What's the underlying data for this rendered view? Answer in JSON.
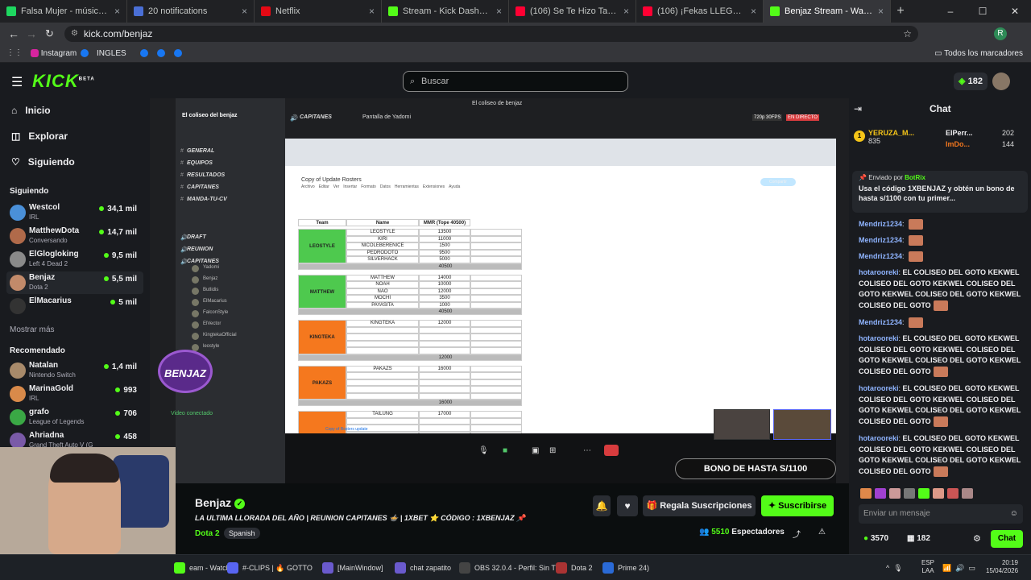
{
  "browser": {
    "tabs": [
      {
        "label": "Falsa Mujer - música y letra de",
        "color": "#1ed760"
      },
      {
        "label": "20 notifications",
        "color": "#4a6fd6"
      },
      {
        "label": "Netflix",
        "color": "#e50914"
      },
      {
        "label": "Stream - Kick Dashboard",
        "color": "#53fc18"
      },
      {
        "label": "(106) Se Te Hizo Tarde (feat. Ele",
        "color": "#ff0033"
      },
      {
        "label": "(106) ¡Fekas LLEGAN a Colo",
        "color": "#ff0033"
      },
      {
        "label": "Benjaz Stream - Watch Live",
        "color": "#53fc18"
      }
    ],
    "url": "kick.com/benjaz",
    "bookmarks": [
      "Instagram",
      "INGLES"
    ],
    "bookmarks_folder": "Todos los marcadores"
  },
  "kick": {
    "logo": "KICK",
    "logo_beta": "BETA",
    "search_placeholder": "Buscar",
    "kicks_balance": "182",
    "nav": [
      {
        "label": "Inicio",
        "icon": "home-icon"
      },
      {
        "label": "Explorar",
        "icon": "compass-icon"
      },
      {
        "label": "Siguiendo",
        "icon": "heart-icon"
      }
    ],
    "following_header": "Siguiendo",
    "following": [
      {
        "name": "Westcol",
        "game": "IRL",
        "viewers": "34,1 mil",
        "color": "#4a90d9"
      },
      {
        "name": "MatthewDota",
        "game": "Conversando",
        "viewers": "14,7 mil",
        "color": "#b06a4a"
      },
      {
        "name": "ElGlogloking",
        "game": "Left 4 Dead 2",
        "viewers": "9,5 mil",
        "color": "#8a8a8a"
      },
      {
        "name": "Benjaz",
        "game": "Dota 2",
        "viewers": "5,5 mil",
        "color": "#c28a6a"
      },
      {
        "name": "ElMacarius",
        "game": "",
        "viewers": "5 mil",
        "color": "#333"
      }
    ],
    "show_more": "Mostrar más",
    "recommended_header": "Recomendado",
    "recommended": [
      {
        "name": "Natalan",
        "game": "Nintendo Switch",
        "viewers": "1,4 mil",
        "color": "#a88a6a"
      },
      {
        "name": "MarinaGold",
        "game": "IRL",
        "viewers": "993",
        "color": "#d98a4a"
      },
      {
        "name": "grafo",
        "game": "League of Legends",
        "viewers": "706",
        "color": "#3aa845"
      },
      {
        "name": "Ahriadna",
        "game": "Grand Theft Auto V (G",
        "viewers": "458",
        "color": "#7a5aa8"
      }
    ]
  },
  "stream": {
    "discord_server": "El coliseo del benjaz",
    "discord_title": "El coliseo de benjaz",
    "discord_channels": [
      "GENERAL",
      "EQUIPOS",
      "RESULTADOS",
      "CAPITANES",
      "MANDA-TU-CV",
      "DRAFT",
      "REUNION",
      "CAPITANES"
    ],
    "discord_live_label": "EN DIRECTO",
    "discord_voice_channel": "CAPITANES",
    "discord_screen": "Pantalla de Yadomi",
    "discord_quality": "720p 30FPS",
    "voice_users": [
      "Yadomi",
      "Benjaz",
      "Butlidis",
      "ElMacarius",
      "FalconStyle",
      "ElVector",
      "KingtekaOfficial",
      "leostyle"
    ],
    "voice_status": "Video conectado",
    "sheet_title": "Copy of Update Rosters",
    "sheet_menu": [
      "Archivo",
      "Editar",
      "Ver",
      "Insertar",
      "Formato",
      "Datos",
      "Herramientas",
      "Extensiones",
      "Ayuda"
    ],
    "sheet_tab": "Copy of Rosters update",
    "sheet_headers": [
      "Team",
      "Name",
      "MMR (Tope 40500)"
    ],
    "teams": [
      {
        "team": "LEOSTYLE",
        "color": "#4ec94e",
        "players": [
          [
            "LEOSTYLE",
            "13500"
          ],
          [
            "KIRI",
            "11000"
          ],
          [
            "NICOLEBERENICE",
            "1500"
          ],
          [
            "PEDRODOTO",
            "9500"
          ],
          [
            "SILVERHACK",
            "5000"
          ]
        ],
        "total": "40500"
      },
      {
        "team": "MATTHEW",
        "color": "#4ec94e",
        "players": [
          [
            "MATTHEW",
            "14000"
          ],
          [
            "NOAH",
            "10000"
          ],
          [
            "NAO",
            "12000"
          ],
          [
            "MOCHI",
            "3500"
          ],
          [
            "PAYASITA",
            "1000"
          ]
        ],
        "total": "40500"
      },
      {
        "team": "KINGTEKA",
        "color": "#f5781e",
        "players": [
          [
            "KINGTEKA",
            "12000"
          ]
        ],
        "total": "12000"
      },
      {
        "team": "PAKAZS",
        "color": "#f5781e",
        "players": [
          [
            "PAKAZS",
            "16000"
          ]
        ],
        "total": "16000"
      },
      {
        "team": "",
        "color": "#f5781e",
        "players": [
          [
            "TAILUNG",
            "17000"
          ]
        ],
        "total": ""
      }
    ],
    "overlay_badge": "BENJAZ",
    "overlay_promo": "BONO DE HASTA S/1100",
    "streamer": "Benjaz",
    "title": "LA ULTIMA LLORADA DEL AÑO | REUNION CAPITANES 🍲 | 1XBET ⭐ CÓDIGO : 1XBENJAZ 📌",
    "category": "Dota 2",
    "language": "Spanish",
    "gift_label": "Regala Suscripciones",
    "subscribe_label": "Suscribirse",
    "viewers": "5510",
    "viewers_label": "Espectadores"
  },
  "chat": {
    "title": "Chat",
    "top_gifters": [
      {
        "name": "YERUZA_M...",
        "value": "835",
        "rank": "1"
      },
      {
        "name": "ElPerr...",
        "value": "202"
      },
      {
        "name": "ImDo...",
        "value": "144"
      }
    ],
    "pinned_by": "Enviado por",
    "pinned_user": "BotRix",
    "pinned_text": "Usa el código 1XBENJAZ y obtén un bono de hasta s/1100 con tu primer...",
    "messages": [
      {
        "user": "Mendriz1234",
        "text": ""
      },
      {
        "user": "Mendriz1234",
        "text": ""
      },
      {
        "user": "Mendriz1234",
        "text": ""
      },
      {
        "user": "hotarooreki",
        "text": "EL COLISEO DEL GOTO KEKWEL COLISEO DEL GOTO KEKWEL COLISEO DEL GOTO KEKWEL COLISEO DEL GOTO KEKWEL COLISEO DEL GOTO"
      },
      {
        "user": "Mendriz1234",
        "text": ""
      },
      {
        "user": "hotarooreki",
        "text": "EL COLISEO DEL GOTO KEKWEL COLISEO DEL GOTO KEKWEL COLISEO DEL GOTO KEKWEL COLISEO DEL GOTO KEKWEL COLISEO DEL GOTO"
      },
      {
        "user": "hotarooreki",
        "text": "EL COLISEO DEL GOTO KEKWEL COLISEO DEL GOTO KEKWEL COLISEO DEL GOTO KEKWEL COLISEO DEL GOTO KEKWEL COLISEO DEL GOTO"
      },
      {
        "user": "hotarooreki",
        "text": "EL COLISEO DEL GOTO KEKWEL COLISEO DEL GOTO KEKWEL COLISEO DEL GOTO KEKWEL COLISEO DEL GOTO KEKWEL COLISEO DEL GOTO"
      }
    ],
    "input_placeholder": "Enviar un mensaje",
    "points": "3570",
    "kicks": "182",
    "send_label": "Chat"
  },
  "taskbar": {
    "items": [
      "eam - Watch l",
      "#-CLIPS | 🔥 GOTTO",
      "[MainWindow]",
      "chat zapatito",
      "OBS 32.0.4 - Perfil: Sin T",
      "Dota 2",
      "Prime 24)"
    ],
    "lang": "ESP",
    "lang2": "LAA",
    "time": "20:19",
    "date": "15/04/2026"
  }
}
